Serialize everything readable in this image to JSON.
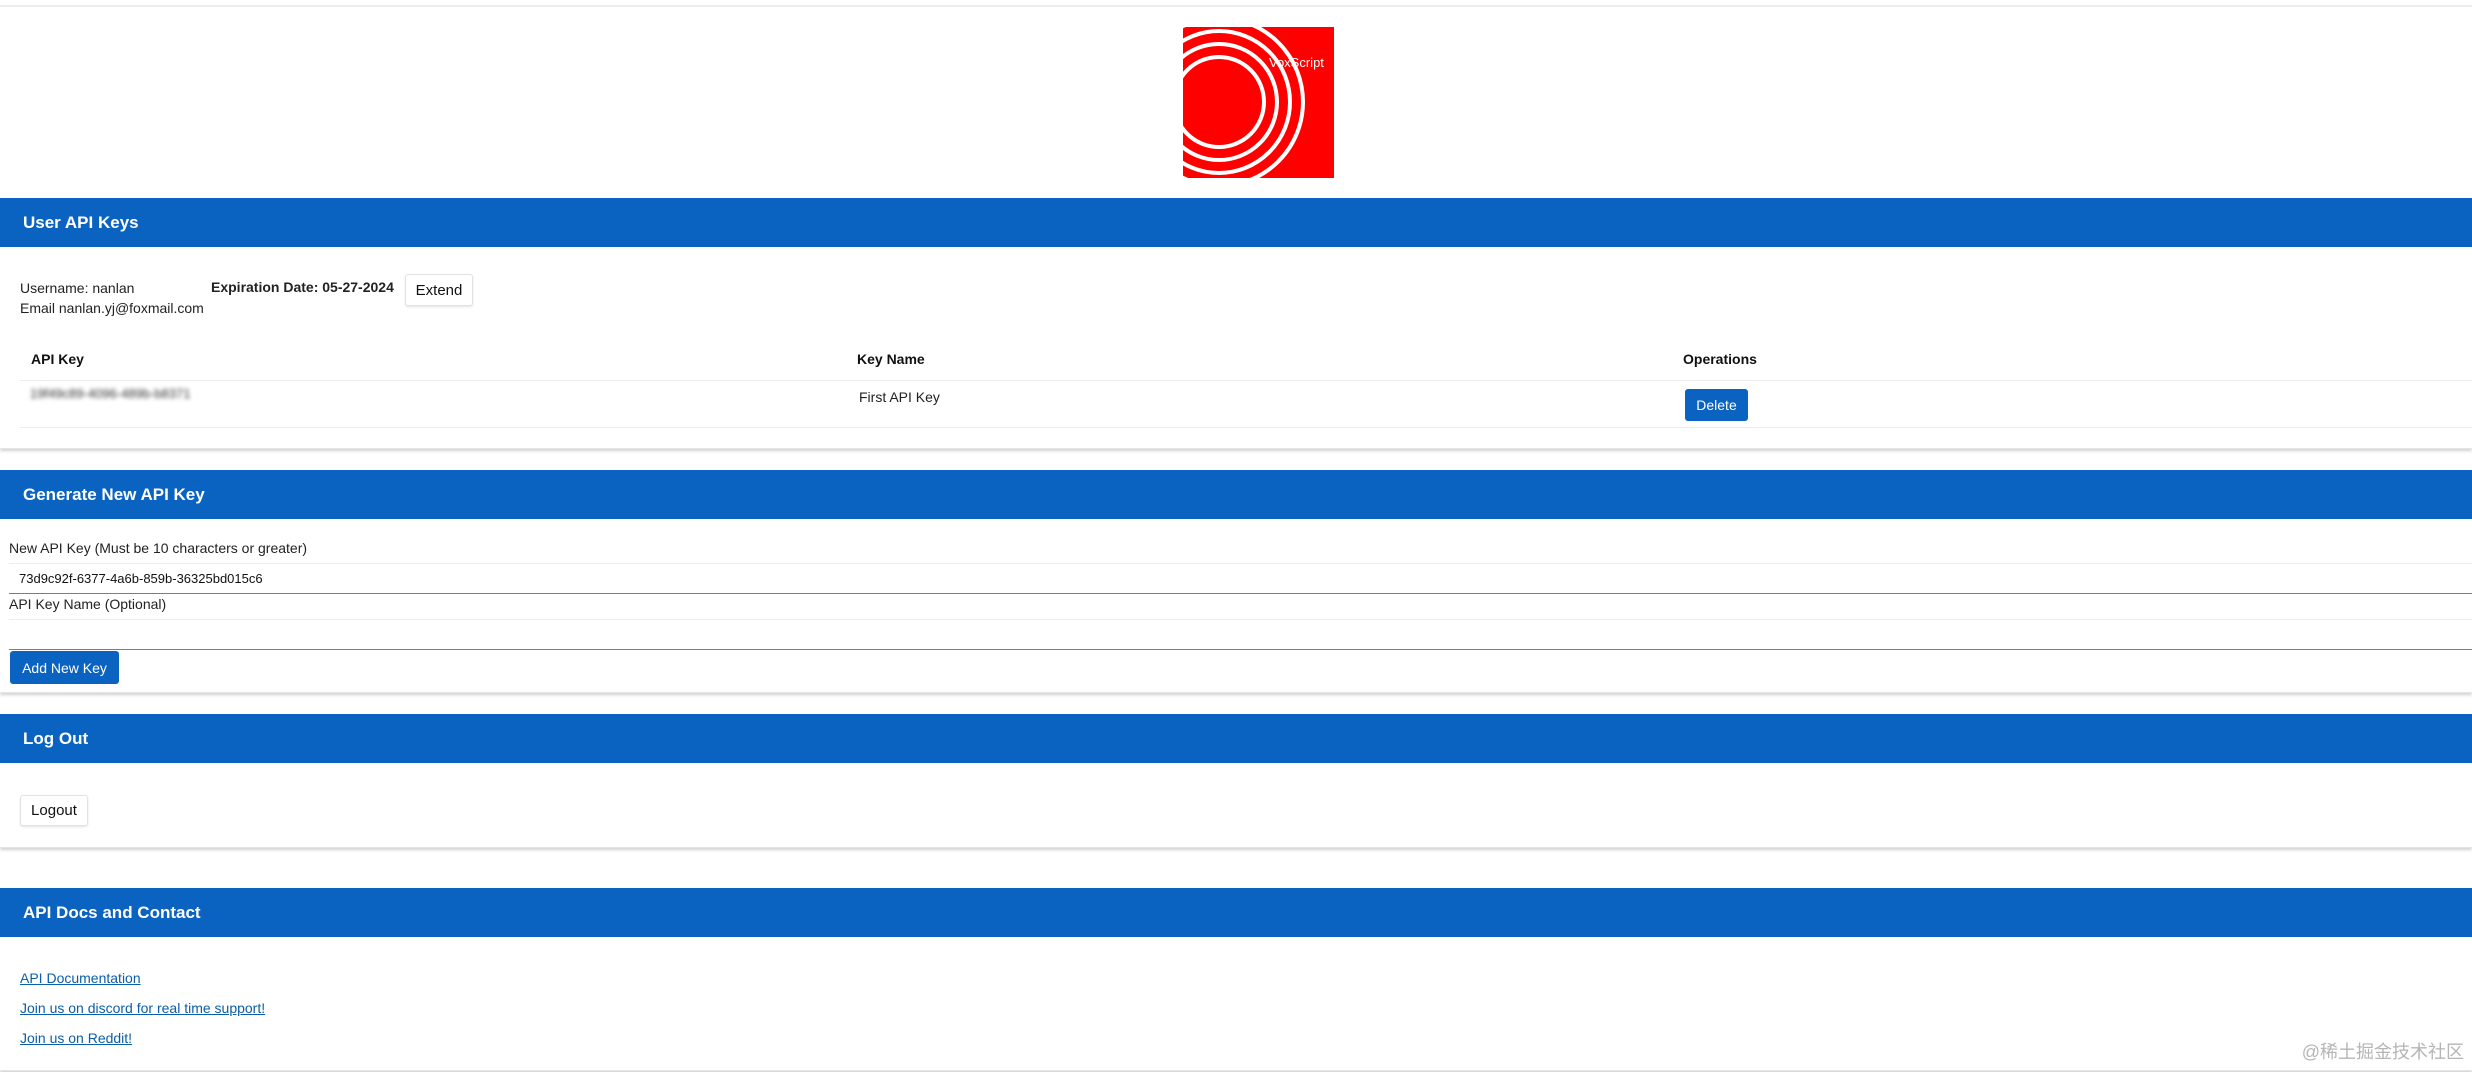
{
  "brand": {
    "name": "VoxScript",
    "logo_bg": "#ff0000"
  },
  "colors": {
    "header_blue": "#0b63c1",
    "link_blue": "#0b5ea8"
  },
  "user_keys": {
    "title": "User API Keys",
    "username_text": "Username: nanlan",
    "email_text": "Email nanlan.yj@foxmail.com",
    "expiration_text": "Expiration Date: 05-27-2024",
    "extend_label": "Extend",
    "columns": {
      "api_key": "API Key",
      "key_name": "Key Name",
      "operations": "Operations"
    },
    "rows": [
      {
        "api_key": "19f49c89-4096-489b-b8371",
        "key_name": "First API Key",
        "delete_label": "Delete"
      }
    ]
  },
  "generate": {
    "title": "Generate New API Key",
    "new_key_label": "New API Key (Must be 10 characters or greater)",
    "new_key_value": "73d9c92f-6377-4a6b-859b-36325bd015c6",
    "name_label": "API Key Name (Optional)",
    "name_value": "",
    "add_label": "Add New Key"
  },
  "logout": {
    "title": "Log Out",
    "button_label": "Logout"
  },
  "docs": {
    "title": "API Docs and Contact",
    "links": [
      "API Documentation",
      "Join us on discord for real time support!",
      "Join us on Reddit!"
    ]
  },
  "watermark": "@稀土掘金技术社区"
}
